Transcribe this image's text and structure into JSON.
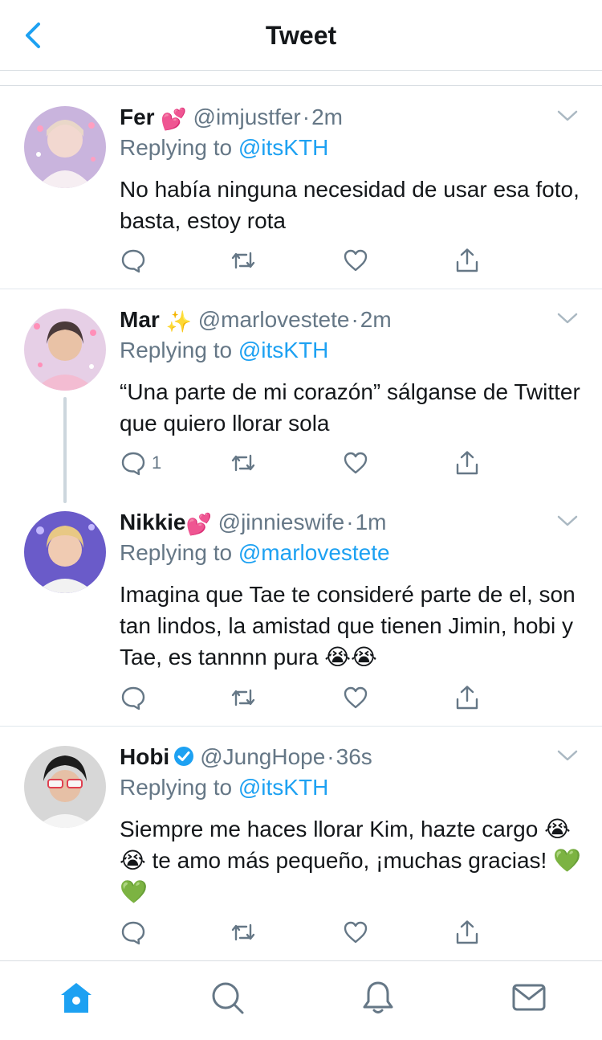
{
  "header": {
    "title": "Tweet"
  },
  "tweets": [
    {
      "name": "Fer",
      "name_emoji": "💕",
      "handle": "@imjustfer",
      "dot": "·",
      "time": "2m",
      "replying_prefix": "Replying to",
      "replying_to": "@itsKTH",
      "body": "No había ninguna necesidad de usar esa foto, basta, estoy rota",
      "reply_count": ""
    },
    {
      "name": "Mar",
      "name_emoji": "✨",
      "handle": "@marlovestete",
      "dot": "·",
      "time": "2m",
      "replying_prefix": "Replying to",
      "replying_to": "@itsKTH",
      "body": "“Una parte de mi corazón” sálganse de Twitter que quiero llorar sola",
      "reply_count": "1"
    },
    {
      "name": "Nikkie",
      "name_emoji": "💕",
      "handle": "@jinnieswife",
      "dot": "·",
      "time": "1m",
      "replying_prefix": "Replying to",
      "replying_to": "@marlovestete",
      "body": "Imagina que Tae te consideré parte de el, son tan lindos, la amistad que tienen Jimin, hobi y Tae, es tannnn pura 😭😭",
      "reply_count": ""
    },
    {
      "name": "Hobi",
      "name_emoji": "",
      "verified": true,
      "handle": "@JungHope",
      "dot": "·",
      "time": "36s",
      "replying_prefix": "Replying to",
      "replying_to": "@itsKTH",
      "body": "Siempre me haces llorar Kim, hazte cargo 😭😭 te amo más pequeño, ¡muchas gracias! 💚💚",
      "reply_count": ""
    }
  ],
  "colors": {
    "accent": "#1da1f2",
    "secondary_text": "#657786",
    "icon_gray": "#657786",
    "divider": "#e1e8ed"
  },
  "icons": {
    "back": "chevron-left-icon",
    "reply": "speech-bubble-icon",
    "retweet": "retweet-icon",
    "like": "heart-icon",
    "share": "share-icon",
    "home": "home-icon",
    "search": "search-icon",
    "notifications": "bell-icon",
    "messages": "envelope-icon"
  }
}
